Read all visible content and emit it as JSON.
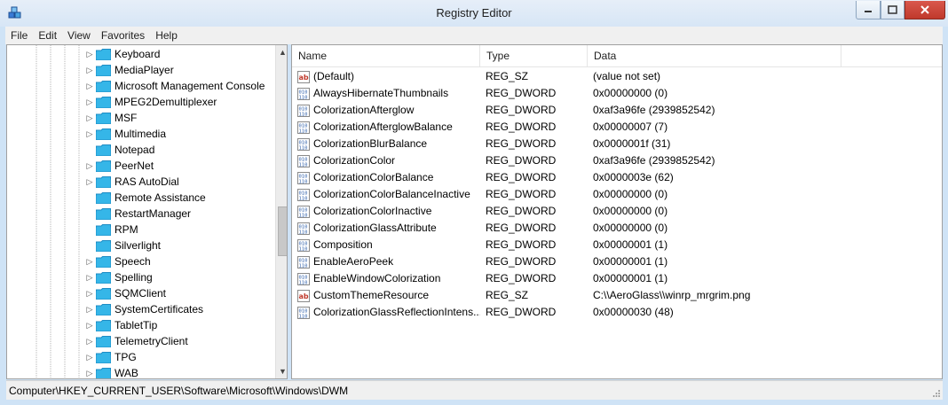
{
  "window": {
    "title": "Registry Editor"
  },
  "menu": [
    "File",
    "Edit",
    "View",
    "Favorites",
    "Help"
  ],
  "tree": {
    "items": [
      {
        "label": "Keyboard",
        "expander": "▷"
      },
      {
        "label": "MediaPlayer",
        "expander": "▷"
      },
      {
        "label": "Microsoft Management Console",
        "expander": "▷"
      },
      {
        "label": "MPEG2Demultiplexer",
        "expander": "▷"
      },
      {
        "label": "MSF",
        "expander": "▷"
      },
      {
        "label": "Multimedia",
        "expander": "▷"
      },
      {
        "label": "Notepad",
        "expander": ""
      },
      {
        "label": "PeerNet",
        "expander": "▷"
      },
      {
        "label": "RAS AutoDial",
        "expander": "▷"
      },
      {
        "label": "Remote Assistance",
        "expander": ""
      },
      {
        "label": "RestartManager",
        "expander": ""
      },
      {
        "label": "RPM",
        "expander": ""
      },
      {
        "label": "Silverlight",
        "expander": ""
      },
      {
        "label": "Speech",
        "expander": "▷"
      },
      {
        "label": "Spelling",
        "expander": "▷"
      },
      {
        "label": "SQMClient",
        "expander": "▷"
      },
      {
        "label": "SystemCertificates",
        "expander": "▷"
      },
      {
        "label": "TabletTip",
        "expander": "▷"
      },
      {
        "label": "TelemetryClient",
        "expander": "▷"
      },
      {
        "label": "TPG",
        "expander": "▷"
      },
      {
        "label": "WAB",
        "expander": "▷"
      }
    ]
  },
  "list": {
    "columns": [
      "Name",
      "Type",
      "Data"
    ],
    "rows": [
      {
        "icon": "string-value-icon",
        "name": "(Default)",
        "type": "REG_SZ",
        "data": "(value not set)"
      },
      {
        "icon": "binary-value-icon",
        "name": "AlwaysHibernateThumbnails",
        "type": "REG_DWORD",
        "data": "0x00000000 (0)"
      },
      {
        "icon": "binary-value-icon",
        "name": "ColorizationAfterglow",
        "type": "REG_DWORD",
        "data": "0xaf3a96fe (2939852542)"
      },
      {
        "icon": "binary-value-icon",
        "name": "ColorizationAfterglowBalance",
        "type": "REG_DWORD",
        "data": "0x00000007 (7)"
      },
      {
        "icon": "binary-value-icon",
        "name": "ColorizationBlurBalance",
        "type": "REG_DWORD",
        "data": "0x0000001f (31)"
      },
      {
        "icon": "binary-value-icon",
        "name": "ColorizationColor",
        "type": "REG_DWORD",
        "data": "0xaf3a96fe (2939852542)"
      },
      {
        "icon": "binary-value-icon",
        "name": "ColorizationColorBalance",
        "type": "REG_DWORD",
        "data": "0x0000003e (62)"
      },
      {
        "icon": "binary-value-icon",
        "name": "ColorizationColorBalanceInactive",
        "type": "REG_DWORD",
        "data": "0x00000000 (0)"
      },
      {
        "icon": "binary-value-icon",
        "name": "ColorizationColorInactive",
        "type": "REG_DWORD",
        "data": "0x00000000 (0)"
      },
      {
        "icon": "binary-value-icon",
        "name": "ColorizationGlassAttribute",
        "type": "REG_DWORD",
        "data": "0x00000000 (0)"
      },
      {
        "icon": "binary-value-icon",
        "name": "Composition",
        "type": "REG_DWORD",
        "data": "0x00000001 (1)"
      },
      {
        "icon": "binary-value-icon",
        "name": "EnableAeroPeek",
        "type": "REG_DWORD",
        "data": "0x00000001 (1)"
      },
      {
        "icon": "binary-value-icon",
        "name": "EnableWindowColorization",
        "type": "REG_DWORD",
        "data": "0x00000001 (1)"
      },
      {
        "icon": "string-value-icon",
        "name": "CustomThemeResource",
        "type": "REG_SZ",
        "data": "C:\\\\AeroGlass\\\\winrp_mrgrim.png"
      },
      {
        "icon": "binary-value-icon",
        "name": "ColorizationGlassReflectionIntens...",
        "type": "REG_DWORD",
        "data": "0x00000030 (48)"
      }
    ]
  },
  "status": {
    "path": "Computer\\HKEY_CURRENT_USER\\Software\\Microsoft\\Windows\\DWM"
  },
  "colors": {
    "folder": "#35b6e8",
    "window_frame": "#cfe3f6"
  }
}
